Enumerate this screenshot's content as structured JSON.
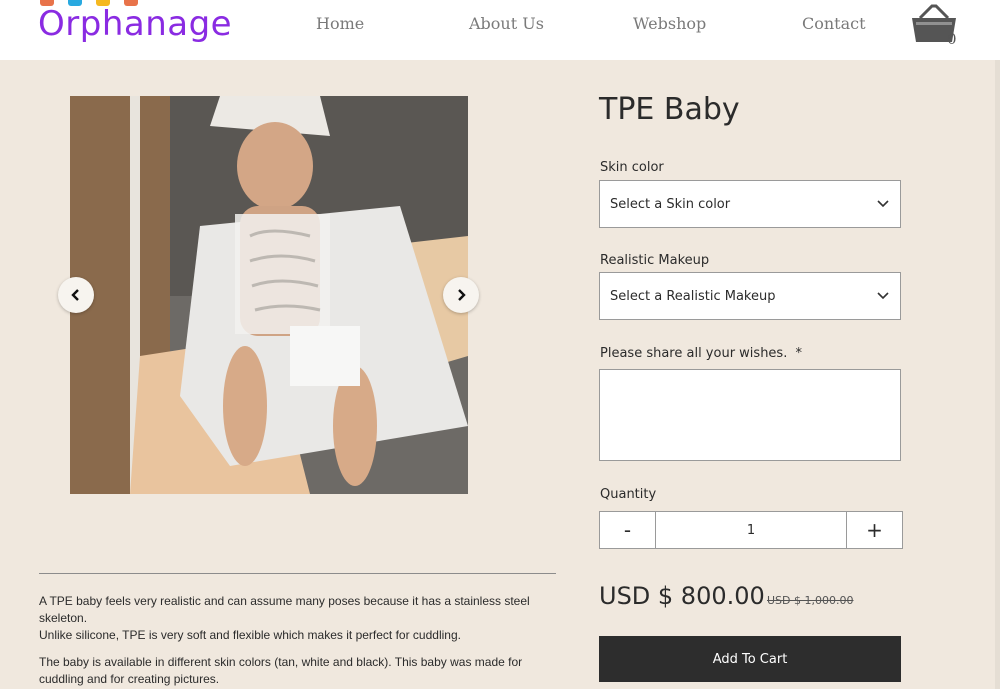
{
  "brand": {
    "name": "Orphanage",
    "word_color": "#8a2be2",
    "top_colors": [
      "#e8734a",
      "#29a9e0",
      "#f5b820",
      "#e8734a"
    ]
  },
  "nav": {
    "items": [
      "Home",
      "About Us",
      "Webshop",
      "Contact"
    ]
  },
  "cart": {
    "count": "0",
    "icon": "basket-icon"
  },
  "gallery": {
    "prev_icon": "chevron-left-icon",
    "next_icon": "chevron-right-icon"
  },
  "product": {
    "title": "TPE Baby",
    "skin_label": "Skin color",
    "skin_placeholder": "Select a Skin color",
    "makeup_label": "Realistic Makeup",
    "makeup_placeholder": "Select a Realistic Makeup",
    "wishes_label": "Please share all your wishes.",
    "wishes_required": "*",
    "quantity_label": "Quantity",
    "qty_minus": "-",
    "qty_value": "1",
    "qty_plus": "+",
    "price": "USD $ 800.00",
    "old_price": "USD $ 1,000.00",
    "add_to_cart": "Add To Cart"
  },
  "description": {
    "p1_line1": "A TPE baby feels very realistic and can assume many poses because it has a stainless steel",
    "p1_line2": "skeleton.",
    "p1_line3": "Unlike silicone, TPE is very soft and flexible which makes it perfect for cuddling.",
    "p2_line1": "The baby is available in different skin colors (tan, white and black). This baby was made for",
    "p2_line2": "cuddling and for creating pictures."
  }
}
